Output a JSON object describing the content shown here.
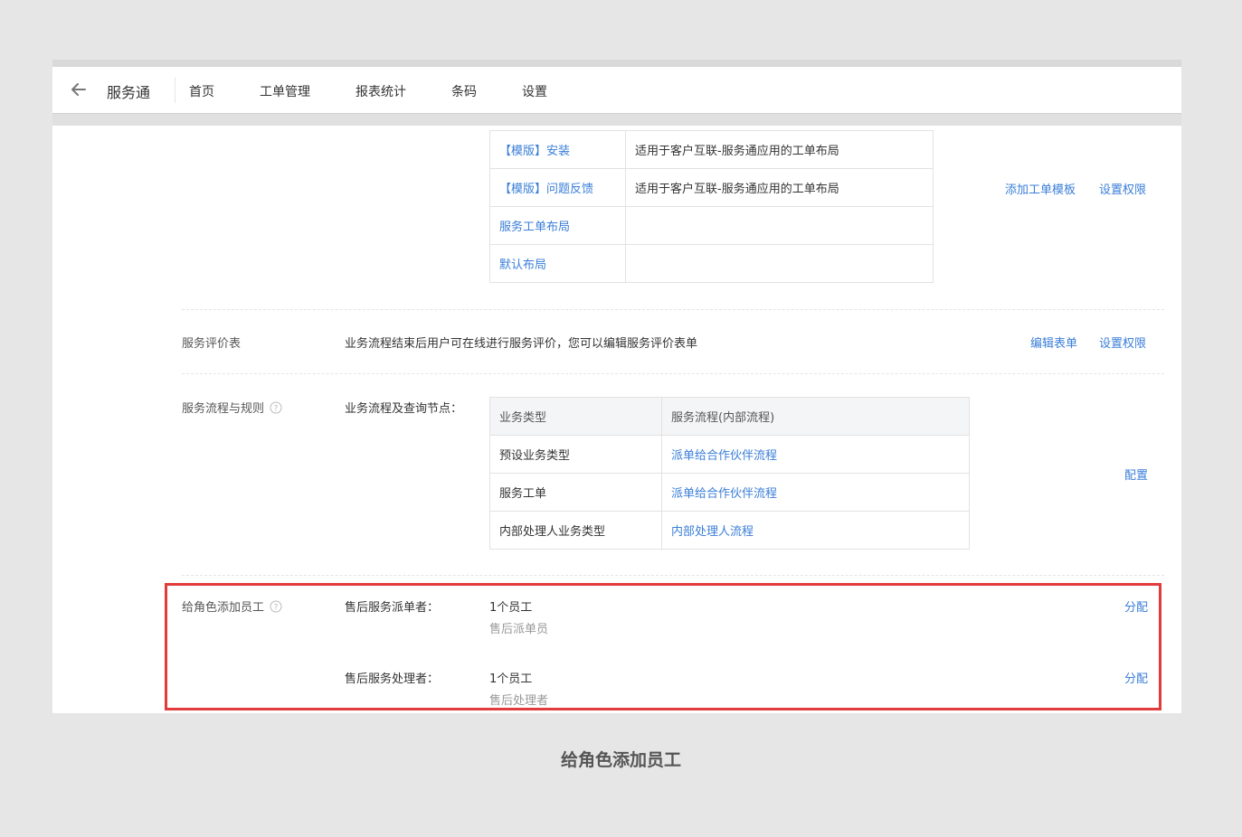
{
  "nav": {
    "app_title": "服务通",
    "tabs": [
      {
        "label": "首页"
      },
      {
        "label": "工单管理"
      },
      {
        "label": "报表统计"
      },
      {
        "label": "条码"
      },
      {
        "label": "设置"
      }
    ],
    "active_tab": "设置"
  },
  "layout_section": {
    "rows": [
      {
        "name": "【模版】安装",
        "desc": "适用于客户互联-服务通应用的工单布局"
      },
      {
        "name": "【模版】问题反馈",
        "desc": "适用于客户互联-服务通应用的工单布局"
      },
      {
        "name": "服务工单布局",
        "desc": ""
      },
      {
        "name": "默认布局",
        "desc": ""
      }
    ],
    "actions": {
      "add_template": "添加工单模板",
      "set_permission": "设置权限"
    }
  },
  "evaluation": {
    "label": "服务评价表",
    "desc": "业务流程结束后用户可在线进行服务评价，您可以编辑服务评价表单",
    "actions": {
      "edit_form": "编辑表单",
      "set_permission": "设置权限"
    }
  },
  "process": {
    "label": "服务流程与规则",
    "sub_label": "业务流程及查询节点：",
    "headers": [
      "业务类型",
      "服务流程(内部流程)"
    ],
    "rows": [
      {
        "type": "预设业务类型",
        "flow": "派单给合作伙伴流程"
      },
      {
        "type": "服务工单",
        "flow": "派单给合作伙伴流程"
      },
      {
        "type": "内部处理人业务类型",
        "flow": "内部处理人流程"
      }
    ],
    "action": "配置"
  },
  "roles": {
    "label": "给角色添加员工",
    "items": [
      {
        "role": "售后服务派单者：",
        "count": "1个员工",
        "member": "售后派单员",
        "action": "分配"
      },
      {
        "role": "售后服务处理者：",
        "count": "1个员工",
        "member": "售后处理者",
        "action": "分配"
      }
    ]
  },
  "caption": "给角色添加员工",
  "colors": {
    "accent": "#f08c3e",
    "link": "#3a7ed8",
    "highlight": "#e23b3b"
  }
}
